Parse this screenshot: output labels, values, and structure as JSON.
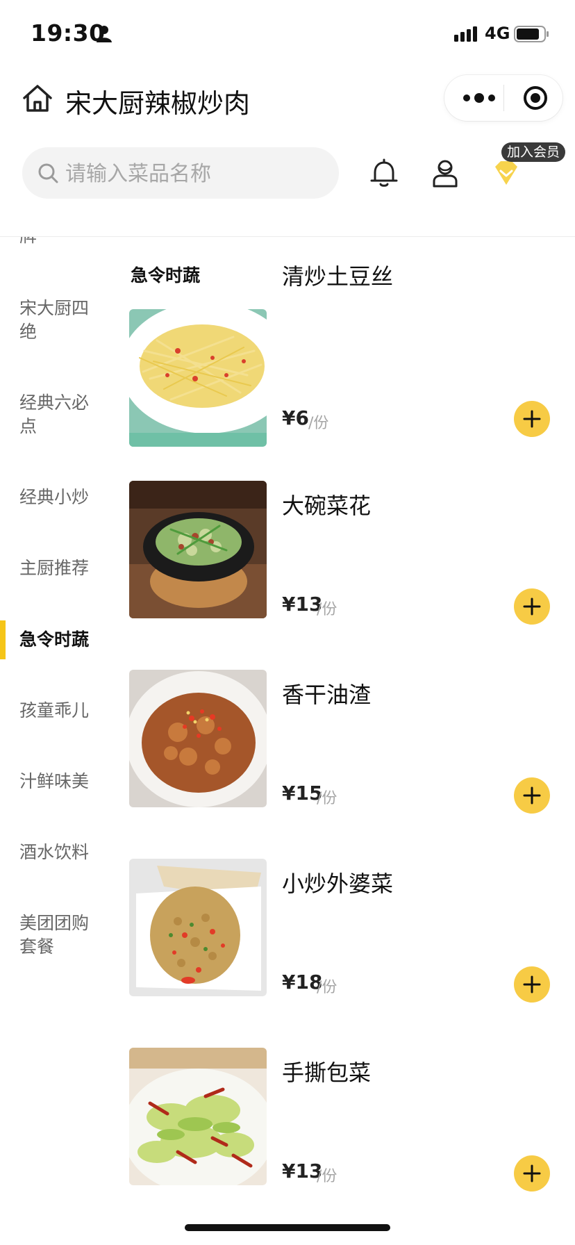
{
  "status_bar": {
    "time": "19:30",
    "network": "4G"
  },
  "title_bar": {
    "title": "宋大厨辣椒炒肉"
  },
  "search": {
    "placeholder": "请输入菜品名称"
  },
  "member": {
    "badge": "加入会员"
  },
  "sidebar": {
    "items": [
      {
        "label": "牌"
      },
      {
        "label": "宋大厨四绝"
      },
      {
        "label": "经典六必点"
      },
      {
        "label": "经典小炒"
      },
      {
        "label": "主厨推荐"
      },
      {
        "label": "急令时蔬"
      },
      {
        "label": "孩童乖儿"
      },
      {
        "label": "汁鲜味美"
      },
      {
        "label": "酒水饮料"
      },
      {
        "label": "美团团购套餐"
      }
    ],
    "active_index": 5
  },
  "section": {
    "title": "急令时蔬"
  },
  "products": [
    {
      "name": "清炒土豆丝",
      "price": "¥6",
      "unit": "/份"
    },
    {
      "name": "大碗菜花",
      "price": "¥13",
      "unit": "/份"
    },
    {
      "name": "香干油渣",
      "price": "¥15",
      "unit": "/份"
    },
    {
      "name": "小炒外婆菜",
      "price": "¥18",
      "unit": "/份"
    },
    {
      "name": "手撕包菜",
      "price": "¥13",
      "unit": "/份"
    }
  ],
  "colors": {
    "accent": "#f7cb45",
    "active_indicator": "#f5c518"
  },
  "icons": [
    "person-icon",
    "signal-icon",
    "battery-icon",
    "home-icon",
    "more-icon",
    "close-target-icon",
    "search-icon",
    "bell-icon",
    "user-icon",
    "member-diamond-icon",
    "plus-icon"
  ]
}
